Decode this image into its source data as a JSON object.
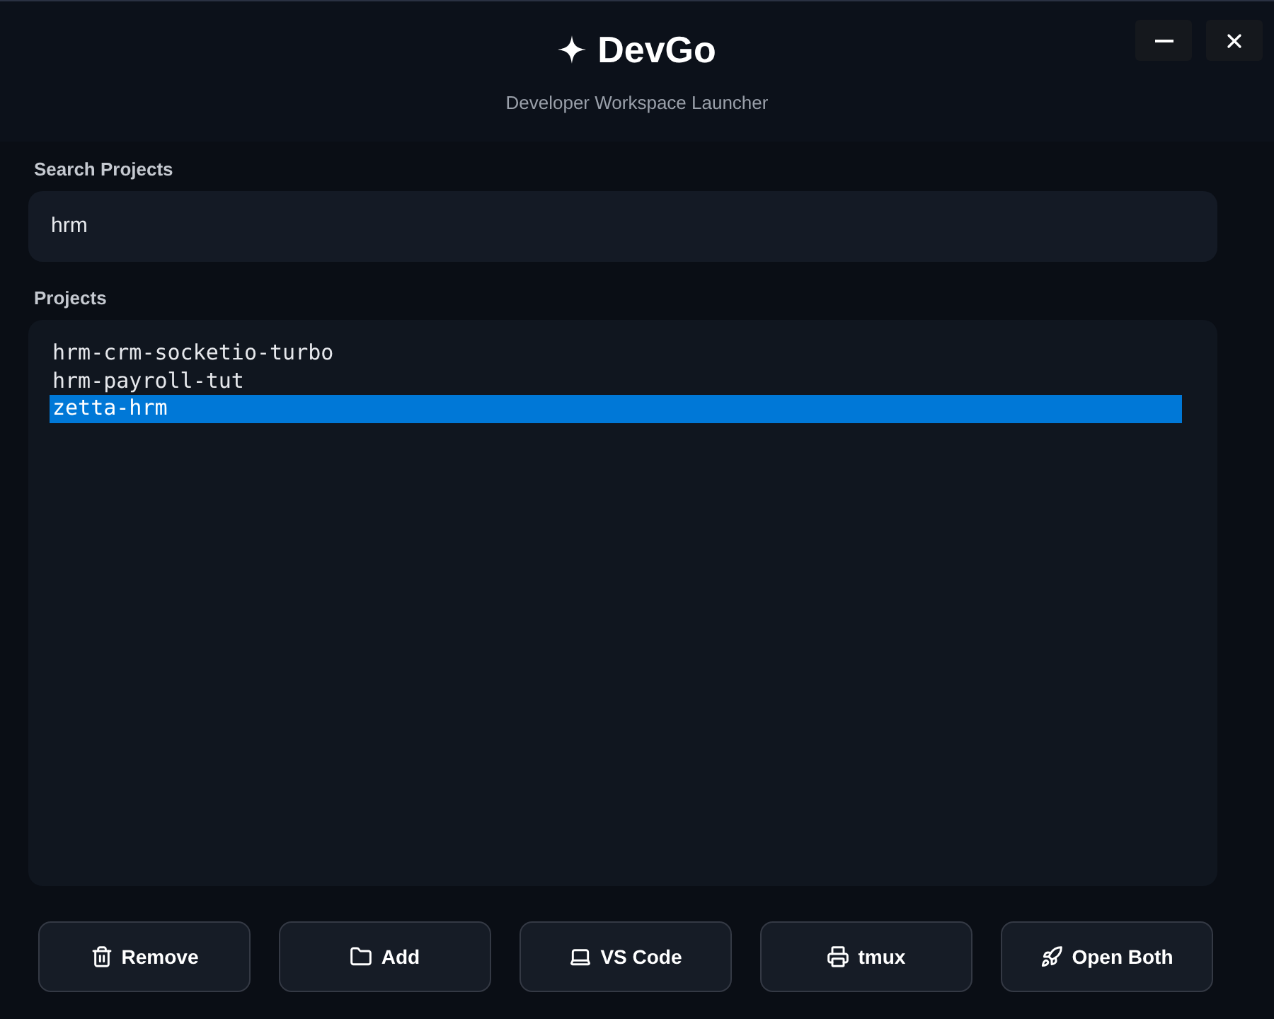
{
  "window": {
    "title": "DevGo",
    "subtitle": "Developer Workspace Launcher"
  },
  "search": {
    "label": "Search Projects",
    "value": "hrm"
  },
  "projects": {
    "label": "Projects",
    "items": [
      {
        "name": "hrm-crm-socketio-turbo",
        "selected": false
      },
      {
        "name": "hrm-payroll-tut",
        "selected": false
      },
      {
        "name": "zetta-hrm",
        "selected": true
      }
    ]
  },
  "buttons": [
    {
      "kind": "remove",
      "label": "Remove"
    },
    {
      "kind": "add",
      "label": "Add"
    },
    {
      "kind": "vscode",
      "label": "VS Code"
    },
    {
      "kind": "tmux",
      "label": "tmux"
    },
    {
      "kind": "both",
      "label": "Open Both"
    }
  ]
}
